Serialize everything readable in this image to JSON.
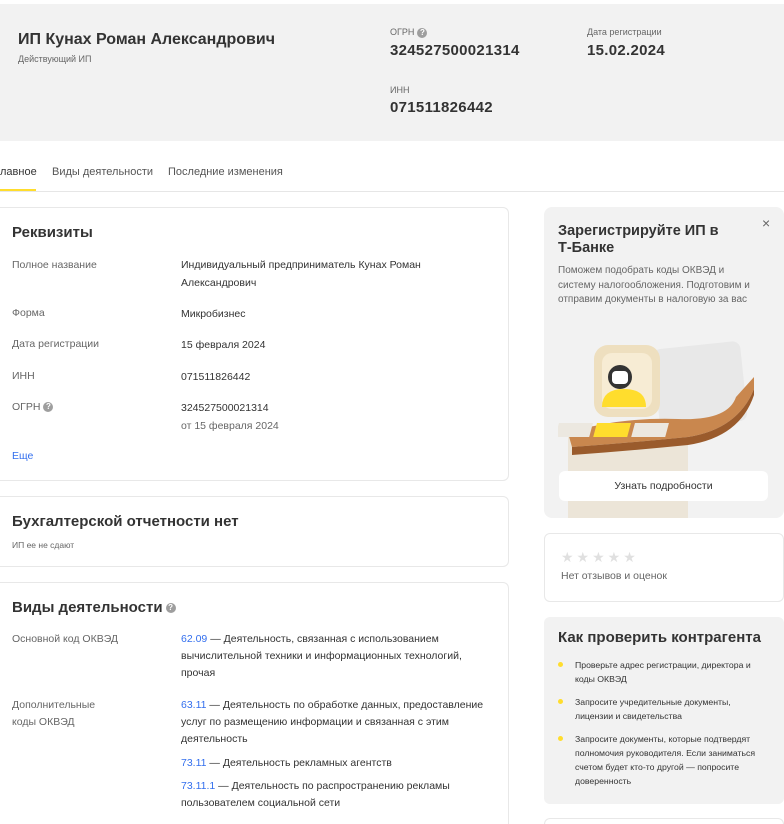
{
  "header": {
    "company_name": "ИП Кунах Роман Александрович",
    "status": "Действующий ИП",
    "ogrn_label": "ОГРН",
    "ogrn_value": "324527500021314",
    "reg_label": "Дата регистрации",
    "reg_value": "15.02.2024",
    "inn_label": "ИНН",
    "inn_value": "071511826442"
  },
  "tabs": [
    {
      "label": "лавное"
    },
    {
      "label": "Виды деятельности"
    },
    {
      "label": "Последние изменения"
    }
  ],
  "requisites": {
    "title": "Реквизиты",
    "full_name_label": "Полное название",
    "full_name_value": "Индивидуальный предприниматель Кунах Роман Александрович",
    "form_label": "Форма",
    "form_value": "Микробизнес",
    "reg_label": "Дата регистрации",
    "reg_value": "15 февраля 2024",
    "inn_label": "ИНН",
    "inn_value": "071511826442",
    "ogrn_label": "ОГРН",
    "ogrn_value": "324527500021314",
    "ogrn_sub": "от 15 февраля 2024",
    "more": "Еще"
  },
  "accounting": {
    "title": "Бухгалтерской отчетности нет",
    "subtitle": "ИП ее не сдают"
  },
  "activities": {
    "title": "Виды деятельности",
    "main_label": "Основной код ОКВЭД",
    "main_code": "62.09",
    "main_desc": " — Деятельность, связанная с использованием вычислительной техники и информационных технологий, прочая",
    "additional_label": "Дополнительные коды ОКВЭД",
    "additional": [
      {
        "code": "63.11",
        "desc": " — Деятельность по обработке данных, предоставление услуг по размещению информации и связанная с этим деятельность"
      },
      {
        "code": "73.11",
        "desc": " — Деятельность рекламных агентств"
      },
      {
        "code": "73.11.1",
        "desc": " — Деятельность по распространению рекламы пользователем социальной сети"
      }
    ]
  },
  "promo": {
    "title": "Зарегистрируйте ИП в Т‑Банке",
    "text": "Поможем подобрать коды ОКВЭД и систему налогообложения. Подготовим и отправим документы в налоговую за вас",
    "close": "×",
    "button": "Узнать подробности"
  },
  "reviews": {
    "stars": "★★★★★",
    "text": "Нет отзывов и оценок",
    "rating": 0
  },
  "check": {
    "title": "Как проверить контрагента",
    "items": [
      "Проверьте адрес регистрации, директора и коды ОКВЭД",
      "Запросите учредительные документы, лицензии и свидетельства",
      "Запросите документы, которые подтвердят полномочия руководителя. Если заниматься счетом будет кто-то другой — попросите доверенность"
    ]
  },
  "icons": {
    "help": "help-circle-icon",
    "close": "close-icon",
    "star": "star-icon"
  },
  "colors": {
    "accent": "#ffdd2d",
    "link": "#336fee",
    "panel": "#f2f2f2"
  }
}
